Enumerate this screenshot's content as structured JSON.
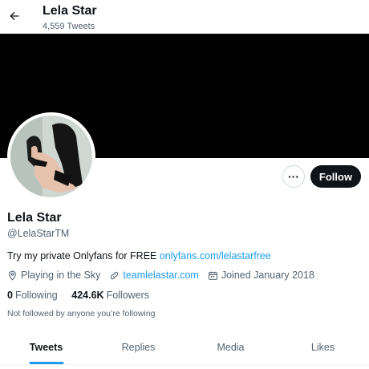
{
  "header": {
    "name": "Lela Star",
    "tweet_count": "4,559 Tweets"
  },
  "profile": {
    "display_name": "Lela Star",
    "handle": "@LelaStarTM",
    "bio_text": "Try my private Onlyfans for FREE ",
    "bio_link": "onlyfans.com/lelastarfree",
    "location": "Playing in the Sky",
    "website": "teamlelastar.com",
    "joined": "Joined January 2018",
    "following_count": "0",
    "following_label": "Following",
    "followers_count": "424.6K",
    "followers_label": "Followers",
    "not_followed_text": "Not followed by anyone you’re following"
  },
  "actions": {
    "more_label": "···",
    "follow_label": "Follow"
  },
  "tabs": [
    {
      "label": "Tweets",
      "active": true
    },
    {
      "label": "Replies",
      "active": false
    },
    {
      "label": "Media",
      "active": false
    },
    {
      "label": "Likes",
      "active": false
    }
  ],
  "colors": {
    "accent": "#1d9bf0",
    "text_primary": "#0f1419",
    "text_secondary": "#536471",
    "banner": "#020202",
    "follow_button": "#0f1419"
  },
  "icons": [
    "back-arrow-icon",
    "location-pin-icon",
    "link-icon",
    "calendar-icon"
  ]
}
